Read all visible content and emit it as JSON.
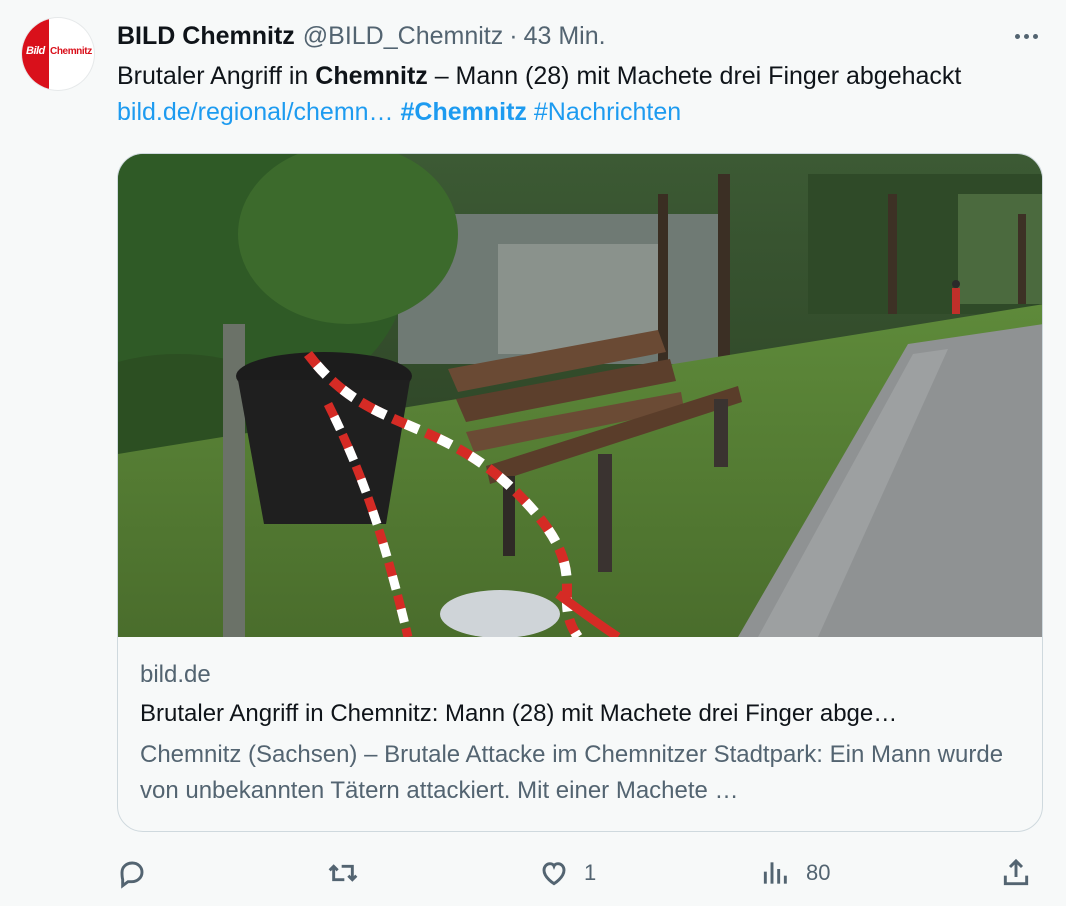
{
  "author": {
    "name": "BILD Chemnitz",
    "handle": "@BILD_Chemnitz",
    "separator": "·",
    "time": "43 Min.",
    "avatar": {
      "brand": "Bild",
      "city": "Chemnitz",
      "brand_color": "#d9101b"
    }
  },
  "tweet": {
    "text_part1": "Brutaler Angriff in ",
    "text_bold": "Chemnitz",
    "text_part2": " – Mann (28) mit Machete drei Finger abgehackt ",
    "link": "bild.de/regional/chemn…",
    "hashtag1": "#Chemnitz",
    "hashtag2": "#Nachrichten"
  },
  "card": {
    "domain": "bild.de",
    "title": "Brutaler Angriff in Chemnitz: Mann (28) mit Machete drei Finger abge…",
    "description": "Chemnitz (Sachsen) – Brutale Attacke im Chemnitzer Stadtpark: Ein Mann wurde von unbekannten Tätern attackiert. Mit einer Machete …"
  },
  "actions": {
    "reply": {
      "icon": "reply-icon",
      "count": ""
    },
    "retweet": {
      "icon": "retweet-icon",
      "count": ""
    },
    "like": {
      "icon": "heart-icon",
      "count": "1"
    },
    "views": {
      "icon": "views-icon",
      "count": "80"
    },
    "share": {
      "icon": "share-icon"
    }
  },
  "colors": {
    "link": "#1d9bf0",
    "secondary_text": "#536471",
    "background": "#f7f9f9"
  }
}
